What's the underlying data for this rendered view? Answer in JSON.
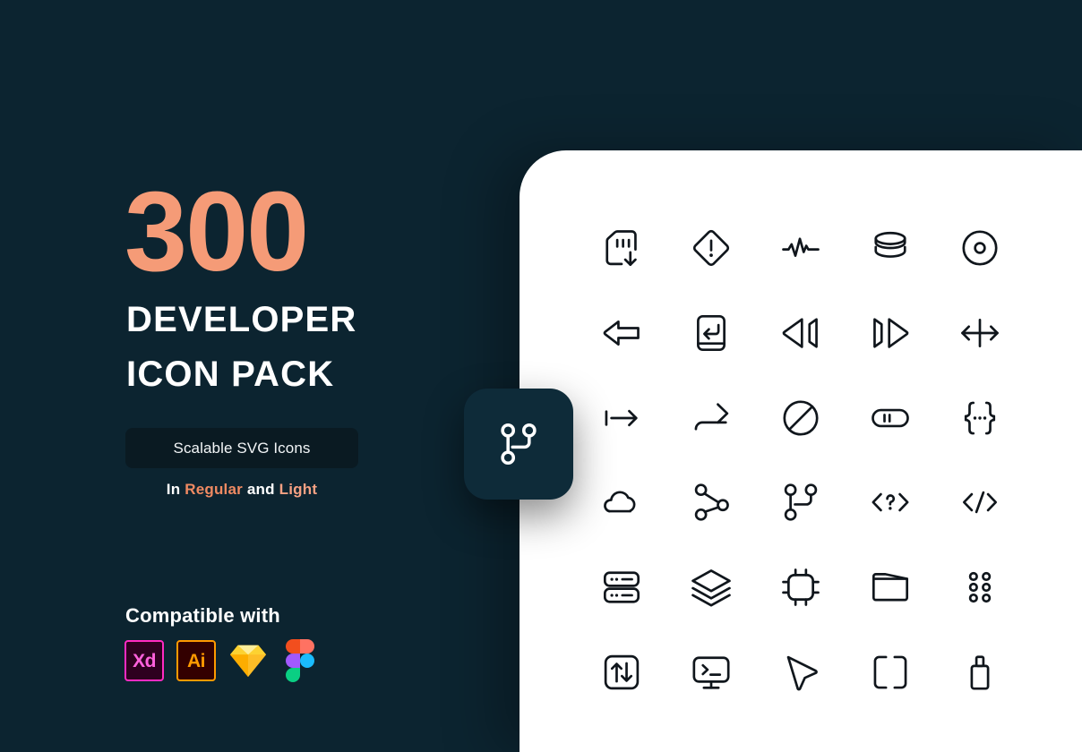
{
  "theme": {
    "background": "#0c2430",
    "card_background": "#ffffff",
    "accent_orange": "#f59b77",
    "accent_light": "#f6a183",
    "badge_background": "#0a1a22",
    "float_badge_background": "#0e2b39",
    "icon_stroke": "#10161c"
  },
  "hero": {
    "number": "300",
    "title_line1": "DEVELOPER",
    "title_line2": "ICON PACK",
    "badge_label": "Scalable SVG Icons",
    "subline": {
      "prefix": "In",
      "style_one": "Regular",
      "conjunction": "and",
      "style_two": "Light"
    }
  },
  "compatibility": {
    "title": "Compatible with",
    "apps": [
      {
        "name": "Adobe XD",
        "abbr": "Xd",
        "icon": "adobe-xd-logo",
        "color": "#ff2bc2"
      },
      {
        "name": "Adobe Illustrator",
        "abbr": "Ai",
        "icon": "adobe-illustrator-logo",
        "color": "#ff9a00"
      },
      {
        "name": "Sketch",
        "abbr": "",
        "icon": "sketch-logo",
        "color": "#fdad00"
      },
      {
        "name": "Figma",
        "abbr": "",
        "icon": "figma-logo",
        "color": "#f24e1e"
      }
    ]
  },
  "float_badge": {
    "icon": "git-branch-icon"
  },
  "icon_grid": {
    "columns": 5,
    "rows": 6,
    "icons": [
      {
        "name": "sim-card-download-icon",
        "label": "SIM Card Download"
      },
      {
        "name": "alert-diamond-icon",
        "label": "Alert Diamond"
      },
      {
        "name": "activity-pulse-icon",
        "label": "Activity Pulse"
      },
      {
        "name": "database-stack-icon",
        "label": "Database"
      },
      {
        "name": "disc-icon",
        "label": "Disc"
      },
      {
        "name": "arrow-left-icon",
        "label": "Arrow Left"
      },
      {
        "name": "enter-key-icon",
        "label": "Enter Key"
      },
      {
        "name": "rewind-icon",
        "label": "Rewind"
      },
      {
        "name": "fast-forward-icon",
        "label": "Fast Forward"
      },
      {
        "name": "resize-horizontal-icon",
        "label": "Resize Horizontal"
      },
      {
        "name": "tab-indent-icon",
        "label": "Tab Indent"
      },
      {
        "name": "redo-arrow-icon",
        "label": "Redo"
      },
      {
        "name": "no-entry-icon",
        "label": "Blocked"
      },
      {
        "name": "pause-toggle-icon",
        "label": "Pause Toggle"
      },
      {
        "name": "curly-braces-ellipsis-icon",
        "label": "Code Block"
      },
      {
        "name": "cloud-icon",
        "label": "Cloud"
      },
      {
        "name": "network-nodes-icon",
        "label": "Network Nodes"
      },
      {
        "name": "git-branch-icon",
        "label": "Git Branch"
      },
      {
        "name": "code-question-icon",
        "label": "Code Help"
      },
      {
        "name": "code-slash-icon",
        "label": "Code"
      },
      {
        "name": "server-rack-icon",
        "label": "Server"
      },
      {
        "name": "layers-icon",
        "label": "Layers"
      },
      {
        "name": "cpu-chip-icon",
        "label": "CPU Chip"
      },
      {
        "name": "folder-icon",
        "label": "Folder"
      },
      {
        "name": "dots-grid-icon",
        "label": "Dots Grid"
      },
      {
        "name": "transfer-vertical-icon",
        "label": "Transfer"
      },
      {
        "name": "terminal-monitor-icon",
        "label": "Terminal"
      },
      {
        "name": "cursor-pointer-icon",
        "label": "Cursor"
      },
      {
        "name": "brackets-icon",
        "label": "Brackets"
      },
      {
        "name": "usb-drive-icon",
        "label": "USB Drive"
      }
    ]
  }
}
